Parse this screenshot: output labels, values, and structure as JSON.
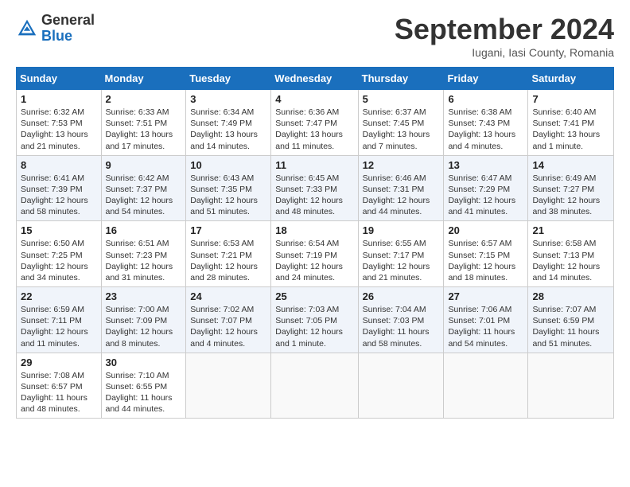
{
  "header": {
    "logo_general": "General",
    "logo_blue": "Blue",
    "month_title": "September 2024",
    "location": "Iugani, Iasi County, Romania"
  },
  "calendar": {
    "days_of_week": [
      "Sunday",
      "Monday",
      "Tuesday",
      "Wednesday",
      "Thursday",
      "Friday",
      "Saturday"
    ],
    "weeks": [
      [
        null,
        null,
        null,
        null,
        null,
        null,
        null
      ]
    ],
    "cells": [
      {
        "day": null,
        "info": ""
      },
      {
        "day": null,
        "info": ""
      },
      {
        "day": null,
        "info": ""
      },
      {
        "day": null,
        "info": ""
      },
      {
        "day": null,
        "info": ""
      },
      {
        "day": null,
        "info": ""
      },
      {
        "day": null,
        "info": ""
      }
    ]
  },
  "weeks": [
    {
      "parity": "odd",
      "days": [
        {
          "num": "1",
          "sunrise": "6:32 AM",
          "sunset": "7:53 PM",
          "daylight": "13 hours and 21 minutes"
        },
        {
          "num": "2",
          "sunrise": "6:33 AM",
          "sunset": "7:51 PM",
          "daylight": "13 hours and 17 minutes"
        },
        {
          "num": "3",
          "sunrise": "6:34 AM",
          "sunset": "7:49 PM",
          "daylight": "13 hours and 14 minutes"
        },
        {
          "num": "4",
          "sunrise": "6:36 AM",
          "sunset": "7:47 PM",
          "daylight": "13 hours and 11 minutes"
        },
        {
          "num": "5",
          "sunrise": "6:37 AM",
          "sunset": "7:45 PM",
          "daylight": "13 hours and 7 minutes"
        },
        {
          "num": "6",
          "sunrise": "6:38 AM",
          "sunset": "7:43 PM",
          "daylight": "13 hours and 4 minutes"
        },
        {
          "num": "7",
          "sunrise": "6:40 AM",
          "sunset": "7:41 PM",
          "daylight": "13 hours and 1 minute"
        }
      ]
    },
    {
      "parity": "even",
      "days": [
        {
          "num": "8",
          "sunrise": "6:41 AM",
          "sunset": "7:39 PM",
          "daylight": "12 hours and 58 minutes"
        },
        {
          "num": "9",
          "sunrise": "6:42 AM",
          "sunset": "7:37 PM",
          "daylight": "12 hours and 54 minutes"
        },
        {
          "num": "10",
          "sunrise": "6:43 AM",
          "sunset": "7:35 PM",
          "daylight": "12 hours and 51 minutes"
        },
        {
          "num": "11",
          "sunrise": "6:45 AM",
          "sunset": "7:33 PM",
          "daylight": "12 hours and 48 minutes"
        },
        {
          "num": "12",
          "sunrise": "6:46 AM",
          "sunset": "7:31 PM",
          "daylight": "12 hours and 44 minutes"
        },
        {
          "num": "13",
          "sunrise": "6:47 AM",
          "sunset": "7:29 PM",
          "daylight": "12 hours and 41 minutes"
        },
        {
          "num": "14",
          "sunrise": "6:49 AM",
          "sunset": "7:27 PM",
          "daylight": "12 hours and 38 minutes"
        }
      ]
    },
    {
      "parity": "odd",
      "days": [
        {
          "num": "15",
          "sunrise": "6:50 AM",
          "sunset": "7:25 PM",
          "daylight": "12 hours and 34 minutes"
        },
        {
          "num": "16",
          "sunrise": "6:51 AM",
          "sunset": "7:23 PM",
          "daylight": "12 hours and 31 minutes"
        },
        {
          "num": "17",
          "sunrise": "6:53 AM",
          "sunset": "7:21 PM",
          "daylight": "12 hours and 28 minutes"
        },
        {
          "num": "18",
          "sunrise": "6:54 AM",
          "sunset": "7:19 PM",
          "daylight": "12 hours and 24 minutes"
        },
        {
          "num": "19",
          "sunrise": "6:55 AM",
          "sunset": "7:17 PM",
          "daylight": "12 hours and 21 minutes"
        },
        {
          "num": "20",
          "sunrise": "6:57 AM",
          "sunset": "7:15 PM",
          "daylight": "12 hours and 18 minutes"
        },
        {
          "num": "21",
          "sunrise": "6:58 AM",
          "sunset": "7:13 PM",
          "daylight": "12 hours and 14 minutes"
        }
      ]
    },
    {
      "parity": "even",
      "days": [
        {
          "num": "22",
          "sunrise": "6:59 AM",
          "sunset": "7:11 PM",
          "daylight": "12 hours and 11 minutes"
        },
        {
          "num": "23",
          "sunrise": "7:00 AM",
          "sunset": "7:09 PM",
          "daylight": "12 hours and 8 minutes"
        },
        {
          "num": "24",
          "sunrise": "7:02 AM",
          "sunset": "7:07 PM",
          "daylight": "12 hours and 4 minutes"
        },
        {
          "num": "25",
          "sunrise": "7:03 AM",
          "sunset": "7:05 PM",
          "daylight": "12 hours and 1 minute"
        },
        {
          "num": "26",
          "sunrise": "7:04 AM",
          "sunset": "7:03 PM",
          "daylight": "11 hours and 58 minutes"
        },
        {
          "num": "27",
          "sunrise": "7:06 AM",
          "sunset": "7:01 PM",
          "daylight": "11 hours and 54 minutes"
        },
        {
          "num": "28",
          "sunrise": "7:07 AM",
          "sunset": "6:59 PM",
          "daylight": "11 hours and 51 minutes"
        }
      ]
    },
    {
      "parity": "odd",
      "days": [
        {
          "num": "29",
          "sunrise": "7:08 AM",
          "sunset": "6:57 PM",
          "daylight": "11 hours and 48 minutes"
        },
        {
          "num": "30",
          "sunrise": "7:10 AM",
          "sunset": "6:55 PM",
          "daylight": "11 hours and 44 minutes"
        },
        null,
        null,
        null,
        null,
        null
      ]
    }
  ]
}
